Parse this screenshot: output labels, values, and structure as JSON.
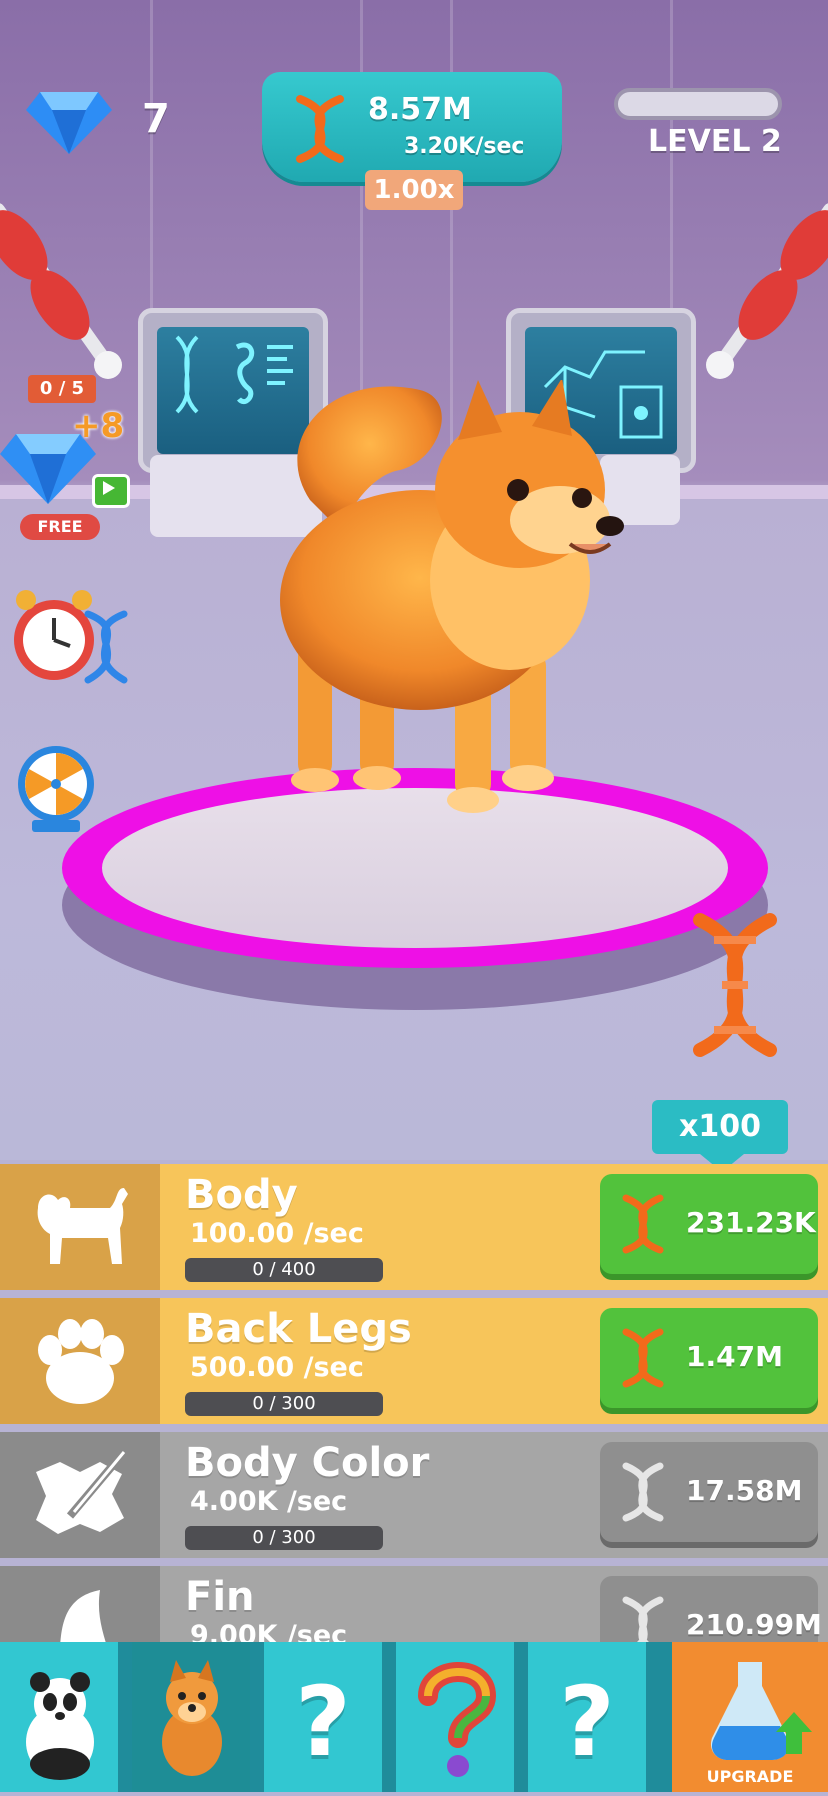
{
  "hud": {
    "gem_count": "7",
    "dna_total": "8.57M",
    "dna_rate": "3.20K/sec",
    "multiplier": "1.00x",
    "level_label": "LEVEL 2",
    "level_progress": 0
  },
  "side_offers": {
    "ad_counter": "0 / 5",
    "gem_bonus": "+8",
    "free_label": "FREE"
  },
  "buy_multiplier": "x100",
  "upgrades": [
    {
      "name": "Body",
      "rate": "100.00 /sec",
      "progress": "0 / 400",
      "cost": "231.23K",
      "affordable": true
    },
    {
      "name": "Back Legs",
      "rate": "500.00 /sec",
      "progress": "0 / 300",
      "cost": "1.47M",
      "affordable": true
    },
    {
      "name": "Body Color",
      "rate": "4.00K /sec",
      "progress": "0 / 300",
      "cost": "17.58M",
      "affordable": false
    },
    {
      "name": "Fin",
      "rate": "9.00K /sec",
      "progress": "",
      "cost": "210.99M",
      "affordable": false
    }
  ],
  "bottom_bar": {
    "slots": [
      "panda",
      "pomeranian",
      "locked",
      "locked-rainbow",
      "locked"
    ],
    "upgrade_label": "UPGRADE"
  },
  "colors": {
    "row_yellow": "#f7c55a",
    "row_yellow_icon": "#d9a248",
    "row_gray": "#a6a6a6",
    "row_gray_icon": "#8b8b8b",
    "buy_green": "#52c23c",
    "buy_gray": "#8f8f8f",
    "platform_ring": "#ee10e6",
    "teal": "#2bbcc4",
    "orange": "#f28c30"
  }
}
